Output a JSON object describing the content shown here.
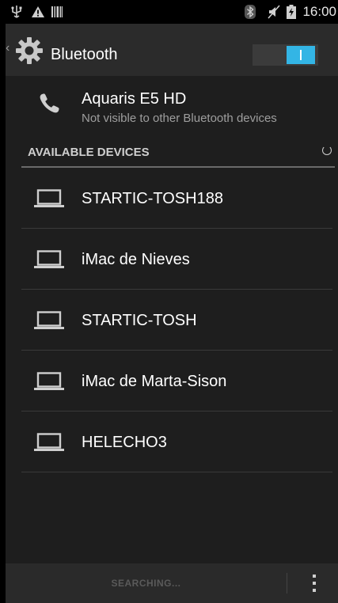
{
  "status_bar": {
    "time": "16:00",
    "icons": [
      "usb-icon",
      "warning-icon",
      "barcode-icon",
      "bluetooth-icon",
      "mute-icon",
      "battery-charging-icon"
    ]
  },
  "action_bar": {
    "title": "Bluetooth",
    "back_glyph": "‹",
    "toggle_state": "on",
    "accent_color": "#33b5e5"
  },
  "own_device": {
    "name": "Aquaris E5 HD",
    "subtitle": "Not visible to other Bluetooth devices"
  },
  "section": {
    "label": "AVAILABLE DEVICES"
  },
  "devices": [
    {
      "label": "STARTIC-TOSH188"
    },
    {
      "label": "iMac de Nieves"
    },
    {
      "label": "STARTIC-TOSH"
    },
    {
      "label": "iMac de Marta-Sison"
    },
    {
      "label": "HELECHO3"
    }
  ],
  "bottom_bar": {
    "searching_label": "SEARCHING..."
  }
}
